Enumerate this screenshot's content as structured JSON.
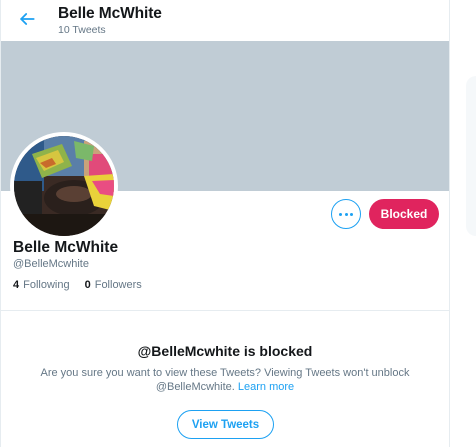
{
  "header": {
    "title": "Belle McWhite",
    "subtitle": "10 Tweets",
    "back_icon": "arrow-left-icon"
  },
  "profile": {
    "name": "Belle McWhite",
    "handle": "@BelleMcwhite",
    "following_count": "4",
    "following_label": "Following",
    "followers_count": "0",
    "followers_label": "Followers",
    "banner_color": "#c0ccd5",
    "more_icon": "more-horizontal-icon",
    "blocked_button_label": "Blocked"
  },
  "blocked_notice": {
    "title": "@BelleMcwhite is blocked",
    "message": "Are you sure you want to view these Tweets? Viewing Tweets won't unblock @BelleMcwhite.",
    "learn_more": "Learn more",
    "view_button_label": "View Tweets"
  },
  "colors": {
    "accent": "#1da1f2",
    "blocked": "#e0245e",
    "muted_text": "#657786"
  }
}
